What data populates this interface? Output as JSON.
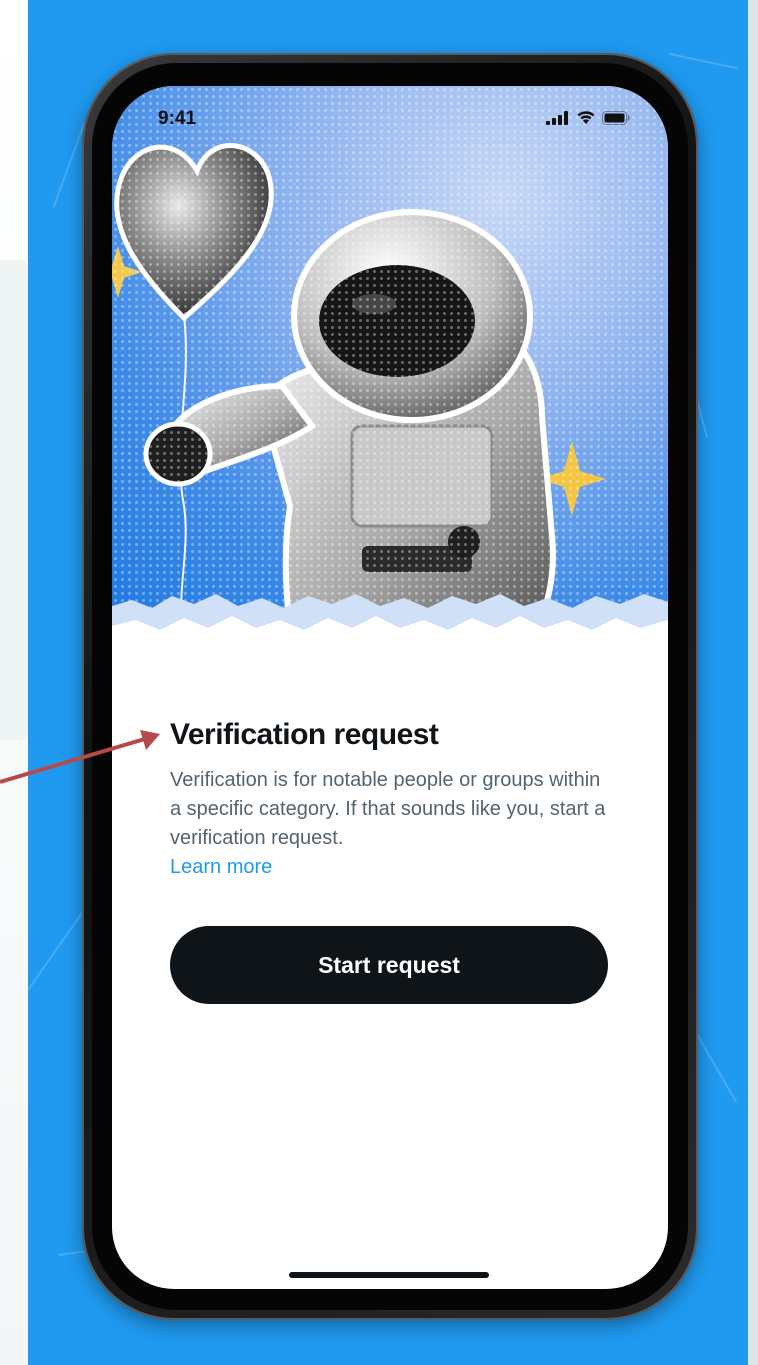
{
  "status_bar": {
    "time": "9:41",
    "icons": [
      "cellular-signal-icon",
      "wifi-icon",
      "battery-icon"
    ]
  },
  "hero": {
    "illustration": "astronaut-with-heart-balloon",
    "decorations": [
      "sparkle-icon",
      "sparkle-icon"
    ]
  },
  "content": {
    "title": "Verification request",
    "body": "Verification is for notable people or groups within a specific category. If that sounds like you, start a verification request.",
    "learn_more": "Learn more"
  },
  "actions": {
    "start_request": "Start request"
  },
  "colors": {
    "background_blue": "#1f9af0",
    "button": "#0f1419",
    "link": "#1d9bf0",
    "body_text": "#536471",
    "title_text": "#0f1419",
    "annotation_arrow": "#b54a4a"
  }
}
